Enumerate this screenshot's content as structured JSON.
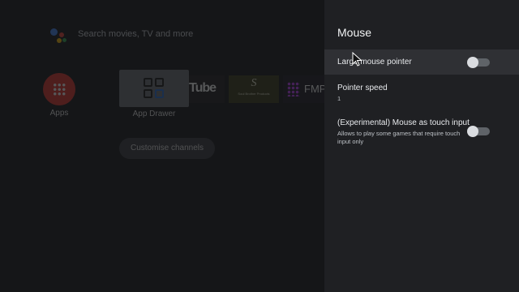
{
  "home": {
    "search_placeholder": "Search movies, TV and more",
    "apps_label": "Apps",
    "app_drawer_label": "App Drawer",
    "youtube_logo_text": "Tube",
    "soul_logo_letter": "S",
    "soul_logo_text": "Soul Brother Products",
    "fmplay_logo_text": "FMPLAY",
    "customise_button": "Customise channels"
  },
  "panel": {
    "title": "Mouse",
    "items": [
      {
        "label": "Large mouse pointer",
        "toggle_on": false
      },
      {
        "label": "Pointer speed",
        "value": "1"
      },
      {
        "label": "(Experimental) Mouse as touch input",
        "description": "Allows to play some games that require touch input only",
        "toggle_on": false
      }
    ]
  },
  "colors": {
    "panel_bg": "#1f2023",
    "highlight_bg": "#2f3034",
    "apps_red": "#e2342a"
  }
}
